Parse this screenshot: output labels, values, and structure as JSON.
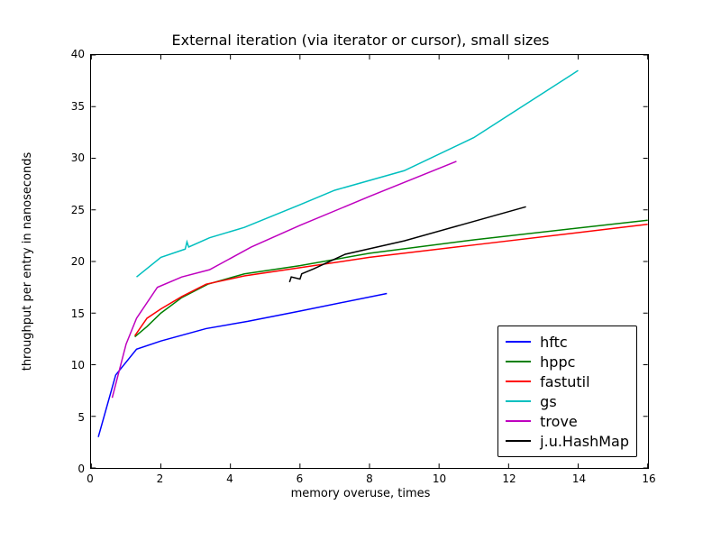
{
  "chart_data": {
    "type": "line",
    "title": "External iteration (via iterator or cursor), small sizes",
    "xlabel": "memory overuse, times",
    "ylabel": "throughput per entry in nanoseconds",
    "xlim": [
      0,
      16
    ],
    "ylim": [
      0,
      40
    ],
    "xticks": [
      0,
      2,
      4,
      6,
      8,
      10,
      12,
      14,
      16
    ],
    "yticks": [
      0,
      5,
      10,
      15,
      20,
      25,
      30,
      35,
      40
    ],
    "legend_position": "lower right",
    "series": [
      {
        "name": "hftc",
        "color": "#0000ff",
        "x": [
          0.2,
          0.7,
          1.3,
          2.0,
          3.3,
          4.5,
          6.0,
          8.5
        ],
        "y": [
          3.0,
          9.0,
          11.5,
          12.3,
          13.5,
          14.2,
          15.2,
          16.9
        ]
      },
      {
        "name": "hppc",
        "color": "#008000",
        "x": [
          1.25,
          1.6,
          2.0,
          2.6,
          3.35,
          4.4,
          6.0,
          8.0,
          11.0,
          16.0
        ],
        "y": [
          12.7,
          13.7,
          15.0,
          16.5,
          17.8,
          18.8,
          19.6,
          20.8,
          22.1,
          24.0
        ]
      },
      {
        "name": "fastutil",
        "color": "#ff0000",
        "x": [
          1.25,
          1.6,
          2.0,
          2.6,
          3.3,
          4.4,
          6.0,
          8.0,
          11.0,
          16.0
        ],
        "y": [
          12.8,
          14.5,
          15.4,
          16.6,
          17.8,
          18.6,
          19.4,
          20.4,
          21.6,
          23.6
        ]
      },
      {
        "name": "gs",
        "color": "#00bfbf",
        "x": [
          1.3,
          2.0,
          2.7,
          2.75,
          2.8,
          3.4,
          4.4,
          6.0,
          7.0,
          9.0,
          11.0,
          14.0
        ],
        "y": [
          18.5,
          20.4,
          21.2,
          21.9,
          21.4,
          22.3,
          23.3,
          25.5,
          26.9,
          28.8,
          32.0,
          38.5
        ]
      },
      {
        "name": "trove",
        "color": "#bf00bf",
        "x": [
          0.6,
          1.0,
          1.3,
          1.9,
          2.6,
          3.4,
          4.6,
          6.0,
          8.0,
          10.5
        ],
        "y": [
          6.8,
          12.0,
          14.5,
          17.5,
          18.5,
          19.2,
          21.4,
          23.5,
          26.3,
          29.7
        ]
      },
      {
        "name": "j.u.HashMap",
        "color": "#000000",
        "x": [
          5.7,
          5.75,
          6.0,
          6.05,
          6.4,
          7.3,
          9.0,
          12.5
        ],
        "y": [
          18.0,
          18.5,
          18.3,
          18.8,
          19.3,
          20.7,
          22.0,
          25.3
        ]
      }
    ]
  },
  "layout": {
    "fig_w": 800,
    "fig_h": 600,
    "axes_left": 100,
    "axes_top": 60,
    "axes_width": 620,
    "axes_height": 460,
    "title_top": 35,
    "xlabel_top": 540,
    "ylabel_left": 38,
    "ylabel_top": 290,
    "legend_right_inset": 12,
    "legend_bottom_inset": 12,
    "tick_len": 5
  }
}
